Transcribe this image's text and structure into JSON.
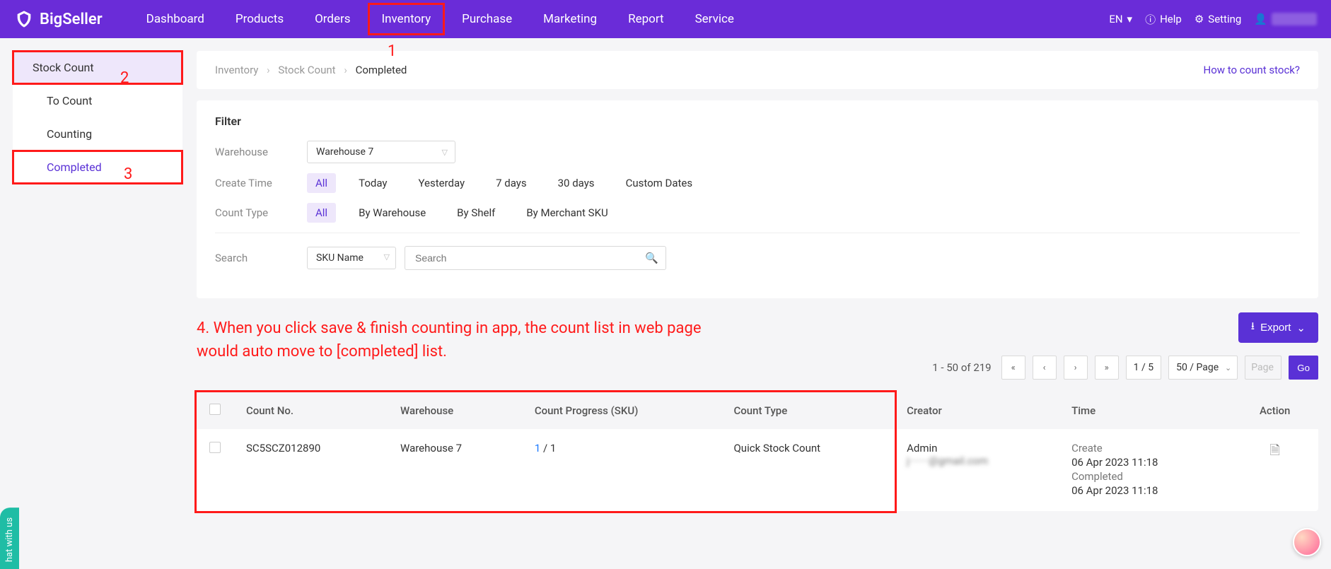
{
  "brand": "BigSeller",
  "nav": {
    "items": [
      "Dashboard",
      "Products",
      "Orders",
      "Inventory",
      "Purchase",
      "Marketing",
      "Report",
      "Service"
    ],
    "highlighted_index": 3,
    "lang": "EN",
    "help": "Help",
    "setting": "Setting"
  },
  "annotations": {
    "n1": "1",
    "n2": "2",
    "n3": "3",
    "step4": "4. When you click save & finish counting in app, the count list in web page would auto move to [completed] list."
  },
  "sidebar": {
    "items": [
      {
        "label": "Stock Count",
        "selected": true,
        "red_box": true
      },
      {
        "label": "To Count",
        "sub": true
      },
      {
        "label": "Counting",
        "sub": true
      },
      {
        "label": "Completed",
        "sub": true,
        "active": true,
        "red_box": true
      }
    ]
  },
  "breadcrumb": {
    "a": "Inventory",
    "b": "Stock Count",
    "c": "Completed"
  },
  "help_link": "How to count stock?",
  "filter": {
    "title": "Filter",
    "warehouse_label": "Warehouse",
    "warehouse_value": "Warehouse 7",
    "create_time_label": "Create Time",
    "time_options": [
      "All",
      "Today",
      "Yesterday",
      "7 days",
      "30 days",
      "Custom Dates"
    ],
    "time_active_index": 0,
    "count_type_label": "Count Type",
    "type_options": [
      "All",
      "By Warehouse",
      "By Shelf",
      "By Merchant SKU"
    ],
    "type_active_index": 0,
    "search_label": "Search",
    "search_select": "SKU Name",
    "search_placeholder": "Search"
  },
  "export_label": "Export",
  "pager": {
    "range_text": "1 - 50 of 219",
    "current": "1 / 5",
    "per_page": "50 / Page",
    "page_placeholder": "Page",
    "go": "Go"
  },
  "table": {
    "headers": {
      "count_no": "Count No.",
      "warehouse": "Warehouse",
      "progress": "Count Progress (SKU)",
      "type": "Count Type",
      "creator": "Creator",
      "time": "Time",
      "action": "Action"
    },
    "row": {
      "count_no": "SC5SCZ012890",
      "warehouse": "Warehouse 7",
      "progress_done": "1",
      "progress_sep": " / ",
      "progress_total": "1",
      "type": "Quick Stock Count",
      "creator_name": "Admin",
      "creator_email": "j·······@gmail.com",
      "create_label": "Create",
      "create_time": "06 Apr 2023 11:18",
      "completed_label": "Completed",
      "completed_time": "06 Apr 2023 11:18"
    }
  },
  "chat_tab": "hat with us"
}
